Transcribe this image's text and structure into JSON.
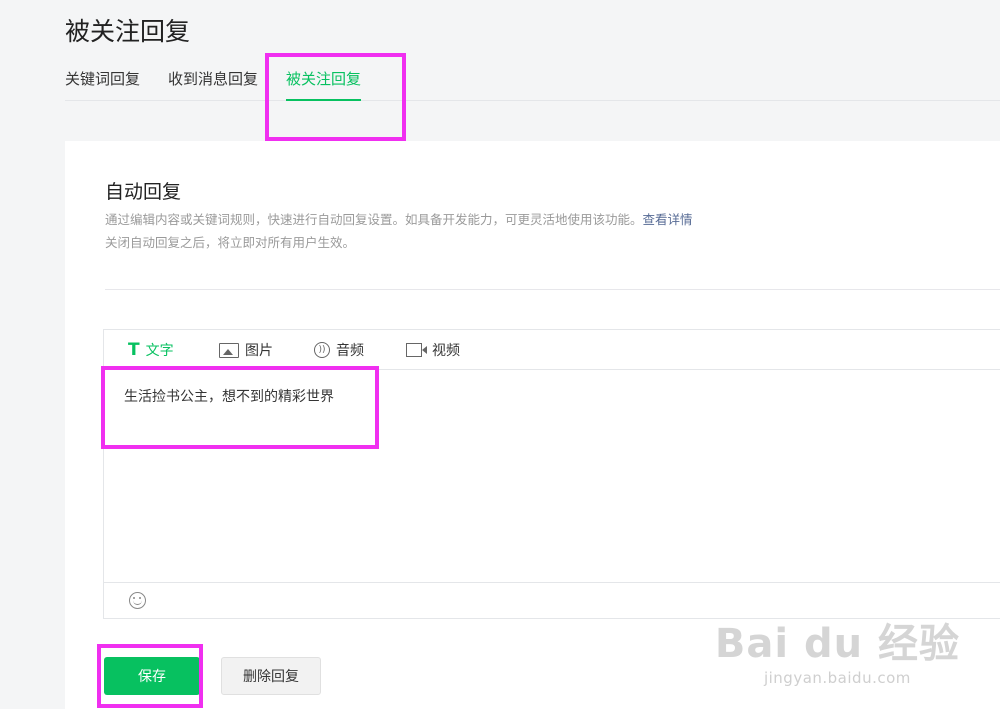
{
  "page": {
    "title": "被关注回复"
  },
  "tabs": [
    {
      "label": "关键词回复",
      "active": false
    },
    {
      "label": "收到消息回复",
      "active": false
    },
    {
      "label": "被关注回复",
      "active": true
    }
  ],
  "section": {
    "title": "自动回复",
    "desc1": "通过编辑内容或关键词规则，快速进行自动回复设置。如具备开发能力，可更灵活地使用该功能。",
    "desc1_link": "查看详情",
    "desc2": "关闭自动回复之后，将立即对所有用户生效。"
  },
  "editor": {
    "tabs": [
      {
        "label": "文字",
        "icon": "text-icon",
        "active": true
      },
      {
        "label": "图片",
        "icon": "image-icon",
        "active": false
      },
      {
        "label": "音频",
        "icon": "audio-icon",
        "active": false
      },
      {
        "label": "视频",
        "icon": "video-icon",
        "active": false
      }
    ],
    "content": "生活捡书公主，想不到的精彩世界",
    "emoji_icon": "emoji-icon"
  },
  "buttons": {
    "save": "保存",
    "delete": "删除回复"
  },
  "watermark": {
    "logo": "Bai du 经验",
    "sub": "jingyan.baidu.com"
  },
  "colors": {
    "accent": "#07c160",
    "link": "#576b95",
    "highlight": "#f02ff0"
  }
}
